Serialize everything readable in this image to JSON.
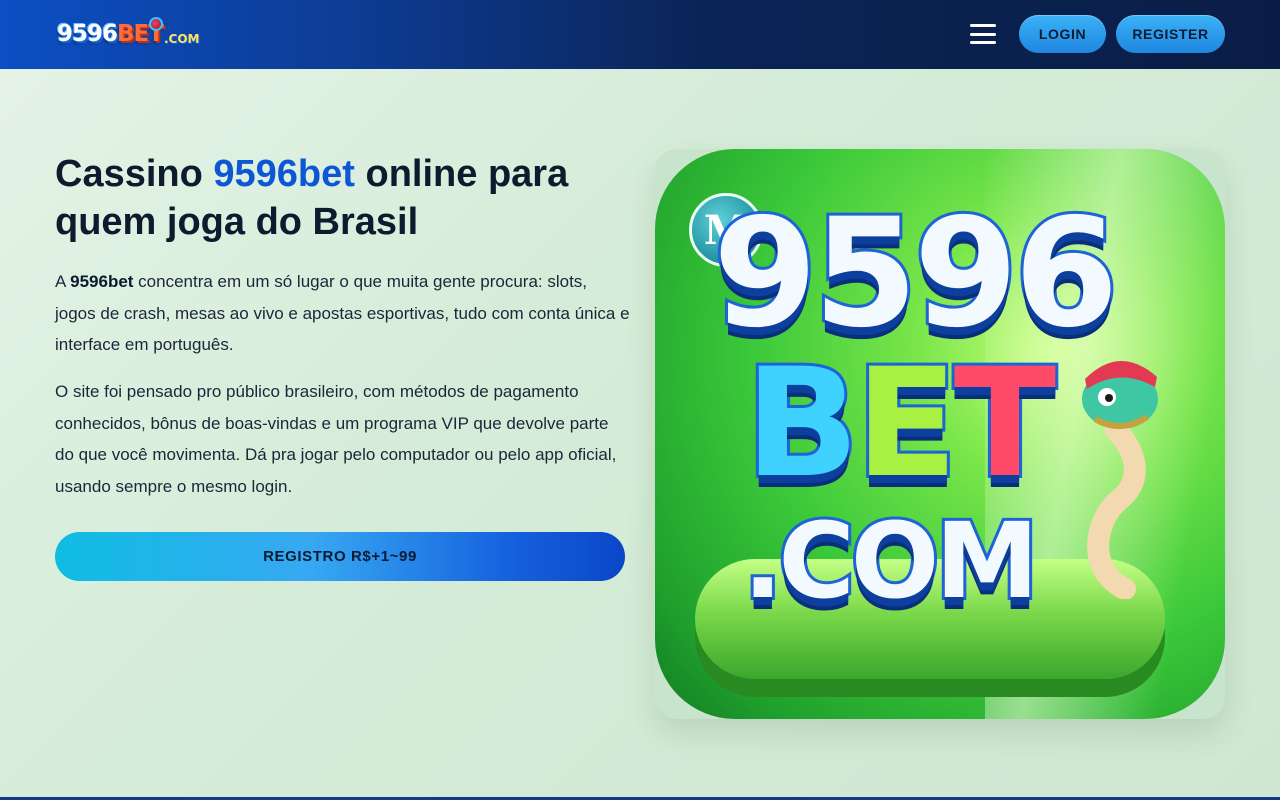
{
  "header": {
    "logo_main": "9596",
    "logo_bet": "BET",
    "logo_com": ".COM",
    "login_label": "LOGIN",
    "register_label": "REGISTER"
  },
  "hero": {
    "title_prefix": "Cassino ",
    "title_accent": "9596bet",
    "title_suffix": " online para quem joga do Brasil",
    "para1_prefix": "A ",
    "para1_strong": "9596bet",
    "para1_rest": " concentra em um só lugar o que muita gente procura: slots, jogos de crash, mesas ao vivo e apostas esportivas, tudo com conta única e interface em português.",
    "para2": "O site foi pensado pro público brasileiro, com métodos de pagamento conhecidos, bônus de boas-vindas e um programa VIP que devolve parte do que você movimenta. Dá pra jogar pelo computador ou pelo app oficial, usando sempre o mesmo login.",
    "cta_label": "REGISTRO R$+1~99"
  },
  "hero_image": {
    "line1": "9596",
    "letter_b": "B",
    "letter_e": "E",
    "letter_t": "T",
    "line3": ".COM",
    "badge": "M"
  },
  "colors": {
    "header_start": "#0c4fc4",
    "header_end": "#0a1d46",
    "accent": "#0d56d4",
    "button": "#2a9ff0"
  },
  "icons": {
    "menu": "hamburger-menu-icon",
    "badge": "m-badge-icon",
    "mascot": "snake-mascot-icon"
  }
}
